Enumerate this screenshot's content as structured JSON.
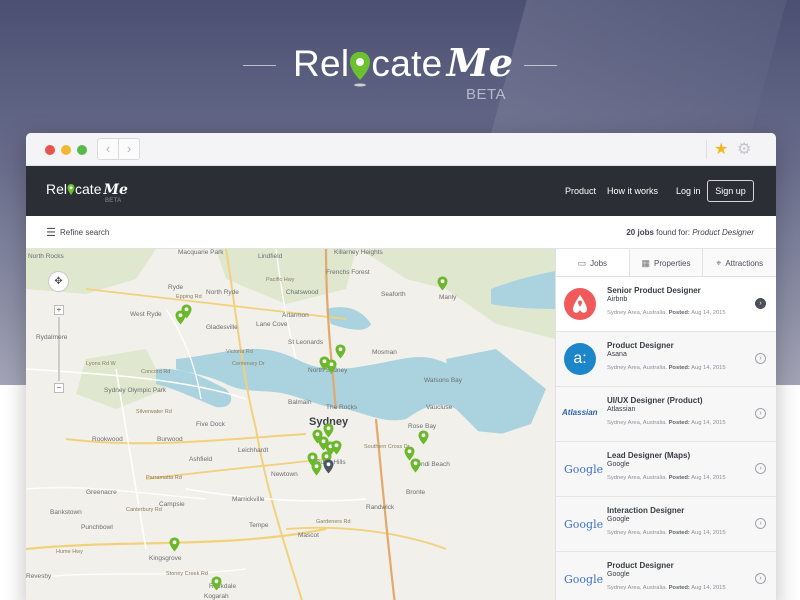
{
  "brand": {
    "logo_text_a": "Rel",
    "logo_text_b": "cate",
    "logo_script": "Me",
    "beta": "BETA"
  },
  "browser": {
    "back_glyph": "‹",
    "forward_glyph": "›",
    "star_icon": "star-icon",
    "gear_icon": "gear-icon"
  },
  "appbar": {
    "logo_a": "Rel",
    "logo_b": "cate",
    "logo_script": "Me",
    "beta": "BETA",
    "nav": [
      "Product",
      "How it works",
      "Log in"
    ],
    "signup": "Sign up"
  },
  "search": {
    "refine": "Refine search",
    "count": "20 jobs",
    "found_for": " found for: ",
    "query": "Product Designer"
  },
  "tabs": [
    {
      "label": "Jobs",
      "icon": "briefcase-icon"
    },
    {
      "label": "Properties",
      "icon": "building-icon"
    },
    {
      "label": "Attractions",
      "icon": "pin-icon"
    }
  ],
  "jobs": [
    {
      "title": "Senior Product Designer",
      "company": "Airbnb",
      "location": "Sydney Area, Australia.",
      "posted_label": "Posted:",
      "posted": "Aug 14, 2015",
      "logo": "airbnb"
    },
    {
      "title": "Product Designer",
      "company": "Asana",
      "location": "Sydney Area, Australia.",
      "posted_label": "Posted:",
      "posted": "Aug 14, 2015",
      "logo": "asana"
    },
    {
      "title": "UI/UX Designer (Product)",
      "company": "Atlassian",
      "location": "Sydney Area, Australia.",
      "posted_label": "Posted:",
      "posted": "Aug 14, 2015",
      "logo": "atlassian"
    },
    {
      "title": "Lead Designer (Maps)",
      "company": "Google",
      "location": "Sydney Area, Australia.",
      "posted_label": "Posted:",
      "posted": "Aug 14, 2015",
      "logo": "google"
    },
    {
      "title": "Interaction Designer",
      "company": "Google",
      "location": "Sydney Area, Australia.",
      "posted_label": "Posted:",
      "posted": "Aug 14, 2015",
      "logo": "google"
    },
    {
      "title": "Product Designer",
      "company": "Google",
      "location": "Sydney Area, Australia.",
      "posted_label": "Posted:",
      "posted": "Aug 14, 2015",
      "logo": "google"
    }
  ],
  "logos": {
    "atlassian": "Atlassian",
    "google": "Google",
    "asana": "a:"
  },
  "map": {
    "labels": [
      "North Rocks",
      "Macquarie Park",
      "Lindfield",
      "Killarney Heights",
      "Frenchs Forest",
      "Ryde",
      "North Ryde",
      "Chatswood",
      "Seaforth",
      "Manly",
      "West Ryde",
      "Lane Cove",
      "Artarmon",
      "Rydalmere",
      "Gladesville",
      "St Leonards",
      "Sydney Olympic Park",
      "North Sydney",
      "Mosman",
      "Watsons Bay",
      "Balmain",
      "The Rocks",
      "Vaucluse",
      "Sydney",
      "Rose Bay",
      "Five Dock",
      "Rookwood",
      "Burwood",
      "Ashfield",
      "Leichhardt",
      "Surry Hills",
      "Bondi Beach",
      "Newtown",
      "Greenacre",
      "Campsie",
      "Marrickville",
      "Bronte",
      "Bankstown",
      "Punchbowl",
      "Randwick",
      "Tempe",
      "Mascot",
      "Kingsgrove",
      "Revesby",
      "Rockdale",
      "Kogarah"
    ],
    "roads": [
      "Epping Rd",
      "Victoria Rd",
      "Parramatta Rd",
      "Canterbury Rd",
      "Stoney Creek Rd",
      "Gardeners Rd",
      "Hume Hwy",
      "Silverwater Rd",
      "Concord Rd",
      "Lyons Rd W",
      "Centenary Dr",
      "Pacific Hwy",
      "Southern Cross Dr"
    ]
  }
}
